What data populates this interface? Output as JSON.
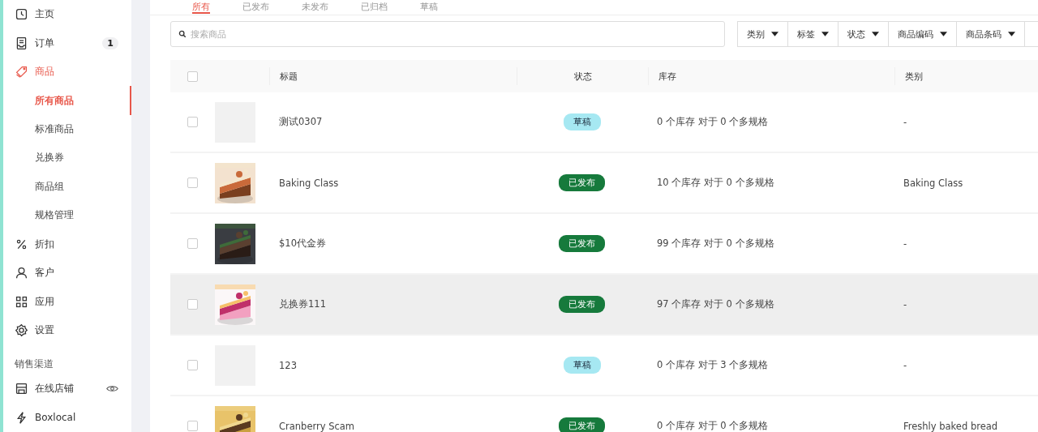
{
  "sidebar": {
    "items": [
      {
        "label": "主页",
        "selected": false
      },
      {
        "label": "订单",
        "selected": false,
        "badge": "1"
      },
      {
        "label": "商品",
        "selected": true,
        "expanded": true,
        "children": [
          {
            "label": "所有商品",
            "selected": true
          },
          {
            "label": "标准商品",
            "selected": false
          },
          {
            "label": "兑换券",
            "selected": false
          },
          {
            "label": "商品组",
            "selected": false
          },
          {
            "label": "规格管理",
            "selected": false
          }
        ]
      },
      {
        "label": "折扣",
        "selected": false
      },
      {
        "label": "客户",
        "selected": false
      },
      {
        "label": "应用",
        "selected": false
      },
      {
        "label": "设置",
        "selected": false
      }
    ],
    "section": "销售渠道",
    "channels": [
      {
        "label": "在线店铺",
        "selected": false
      },
      {
        "label": "Boxlocal",
        "selected": false
      }
    ]
  },
  "tabs": [
    {
      "label": "所有",
      "selected": true
    },
    {
      "label": "已发布",
      "selected": false
    },
    {
      "label": "未发布",
      "selected": false
    },
    {
      "label": "已归档",
      "selected": false
    },
    {
      "label": "草稿",
      "selected": false
    }
  ],
  "search": {
    "placeholder": "搜索商品"
  },
  "filters": [
    "类别",
    "标签",
    "状态",
    "商品编码",
    "商品条码"
  ],
  "table": {
    "select_all_checked": false,
    "columns": [
      "标题",
      "状态",
      "库存",
      "类别"
    ],
    "rows": [
      {
        "checked": false,
        "selected": false,
        "image": {
          "kind": "empty"
        },
        "title": "测试0307",
        "status": {
          "kind": "draft",
          "label": "草稿"
        },
        "stock": "0 个库存 对于 0 个多规格",
        "category": "-"
      },
      {
        "checked": false,
        "selected": false,
        "title": "Baking Class",
        "status": {
          "kind": "published",
          "label": "已发布"
        },
        "stock": "10 个库存 对于 0 个多规格",
        "category": "Baking Class"
      },
      {
        "checked": false,
        "selected": false,
        "title": "$10代金券",
        "status": {
          "kind": "published",
          "label": "已发布"
        },
        "stock": "99 个库存 对于 0 个多规格",
        "category": "-"
      },
      {
        "checked": false,
        "selected": true,
        "title": "兑换券111",
        "status": {
          "kind": "published",
          "label": "已发布"
        },
        "stock": "97 个库存 对于 0 个多规格",
        "category": "-"
      },
      {
        "checked": false,
        "selected": false,
        "image": {
          "kind": "empty"
        },
        "title": "123",
        "status": {
          "kind": "draft",
          "label": "草稿"
        },
        "stock": "0 个库存 对于 3 个多规格",
        "category": "-"
      },
      {
        "checked": false,
        "selected": false,
        "title": "Cranberry Scam",
        "status": {
          "kind": "published",
          "label": "已发布"
        },
        "stock": "0 个库存 对于 0 个多规格",
        "category": "Freshly baked bread"
      }
    ]
  }
}
